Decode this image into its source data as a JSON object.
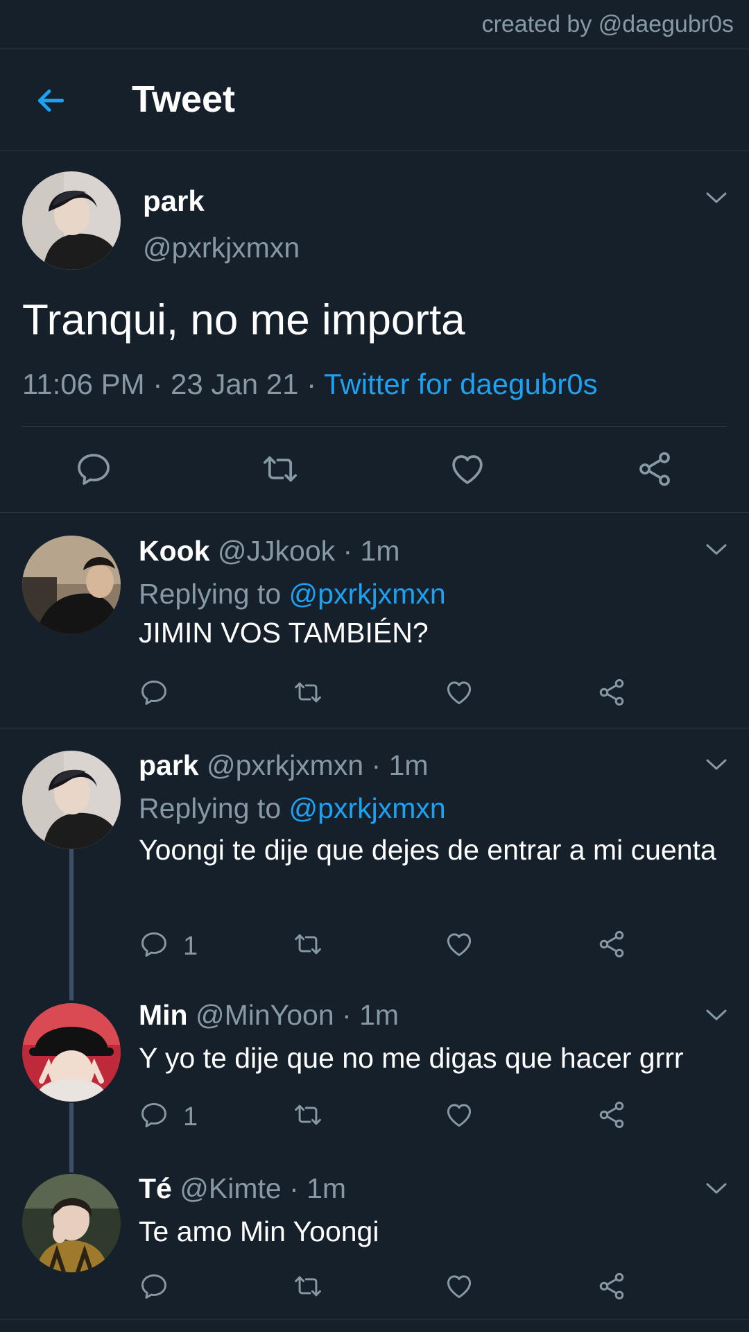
{
  "credit": "created by @daegubr0s",
  "header": {
    "title": "Tweet",
    "back_icon": "arrow-left-icon"
  },
  "colors": {
    "background": "#15202b",
    "accent": "#1da1f2",
    "muted": "#8899a6",
    "divider": "#2f3b47"
  },
  "tweet": {
    "name": "park",
    "handle": "@pxrkjxmxn",
    "text": "Tranqui, no me importa",
    "time": "11:06 PM · 23 Jan 21 · ",
    "source": "Twitter for daegubr0s"
  },
  "replies": [
    {
      "name": "Kook",
      "meta": " @JJkook · 1m",
      "replying_prefix": "Replying to ",
      "replying_handle": "@pxrkjxmxn",
      "text": "JIMIN VOS TAMBIÉN?",
      "reply_count": ""
    },
    {
      "name": "park",
      "meta": " @pxrkjxmxn · 1m",
      "replying_prefix": "Replying to ",
      "replying_handle": "@pxrkjxmxn",
      "text": "Yoongi te dije que dejes de entrar a mi cuenta",
      "reply_count": "1"
    },
    {
      "name": "Min",
      "meta": " @MinYoon · 1m",
      "text": "Y yo te dije que no me digas que hacer grrr",
      "reply_count": "1"
    },
    {
      "name": "Té",
      "meta": " @Kimte · 1m",
      "text": "Te amo Min Yoongi",
      "reply_count": ""
    }
  ]
}
